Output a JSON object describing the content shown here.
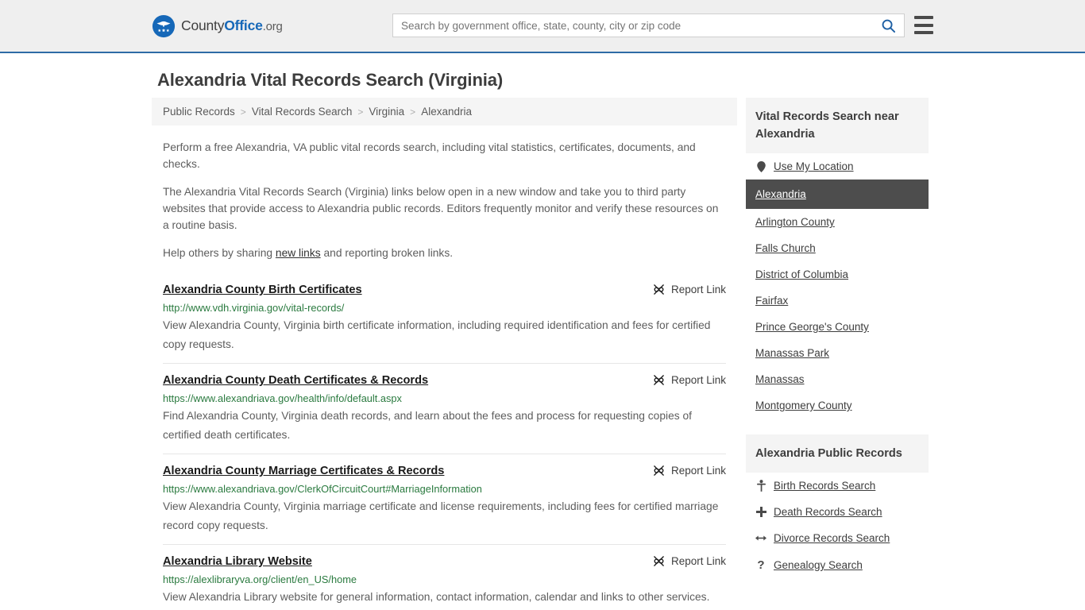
{
  "header": {
    "logo": {
      "icon": "eagle-seal-icon",
      "text_part1": "County",
      "text_part2": "Office",
      "text_part3": ".org"
    },
    "search": {
      "placeholder": "Search by government office, state, county, city or zip code",
      "value": "",
      "button_icon": "search-icon"
    },
    "menu_icon": "hamburger-menu-icon",
    "accent_color": "#2e6ba6"
  },
  "page": {
    "title": "Alexandria Vital Records Search (Virginia)"
  },
  "breadcrumb": {
    "separator": ">",
    "items": [
      {
        "label": "Public Records"
      },
      {
        "label": "Vital Records Search"
      },
      {
        "label": "Virginia"
      },
      {
        "label": "Alexandria"
      }
    ]
  },
  "intro": {
    "paragraph1": "Perform a free Alexandria, VA public vital records search, including vital statistics, certificates, documents, and checks.",
    "paragraph2": "The Alexandria Vital Records Search (Virginia) links below open in a new window and take you to third party websites that provide access to Alexandria public records. Editors frequently monitor and verify these resources on a routine basis.",
    "paragraph3_before": "Help others by sharing ",
    "paragraph3_link": "new links",
    "paragraph3_after": " and reporting broken links."
  },
  "results": {
    "report_label": "Report Link",
    "report_icon": "broken-link-icon",
    "items": [
      {
        "title": "Alexandria County Birth Certificates",
        "url": "http://www.vdh.virginia.gov/vital-records/",
        "description": "View Alexandria County, Virginia birth certificate information, including required identification and fees for certified copy requests."
      },
      {
        "title": "Alexandria County Death Certificates & Records",
        "url": "https://www.alexandriava.gov/health/info/default.aspx",
        "description": "Find Alexandria County, Virginia death records, and learn about the fees and process for requesting copies of certified death certificates."
      },
      {
        "title": "Alexandria County Marriage Certificates & Records",
        "url": "https://www.alexandriava.gov/ClerkOfCircuitCourt#MarriageInformation",
        "description": "View Alexandria County, Virginia marriage certificate and license requirements, including fees for certified marriage record copy requests."
      },
      {
        "title": "Alexandria Library Website",
        "url": "https://alexlibraryva.org/client/en_US/home",
        "description": "View Alexandria Library website for general information, contact information, calendar and links to other services."
      }
    ]
  },
  "sidebar": {
    "nearby": {
      "heading": "Vital Records Search near Alexandria",
      "use_location": {
        "label": "Use My Location",
        "icon": "map-pin-icon"
      },
      "items": [
        {
          "label": "Alexandria",
          "active": true
        },
        {
          "label": "Arlington County",
          "active": false
        },
        {
          "label": "Falls Church",
          "active": false
        },
        {
          "label": "District of Columbia",
          "active": false
        },
        {
          "label": "Fairfax",
          "active": false
        },
        {
          "label": "Prince George's County",
          "active": false
        },
        {
          "label": "Manassas Park",
          "active": false
        },
        {
          "label": "Manassas",
          "active": false
        },
        {
          "label": "Montgomery County",
          "active": false
        }
      ],
      "active_bg": "#4d4d4d"
    },
    "public_records": {
      "heading": "Alexandria Public Records",
      "items": [
        {
          "label": "Birth Records Search",
          "icon": "baby-icon"
        },
        {
          "label": "Death Records Search",
          "icon": "cross-icon"
        },
        {
          "label": "Divorce Records Search",
          "icon": "left-right-arrow-icon"
        },
        {
          "label": "Genealogy Search",
          "icon": "question-mark-icon"
        }
      ]
    }
  }
}
